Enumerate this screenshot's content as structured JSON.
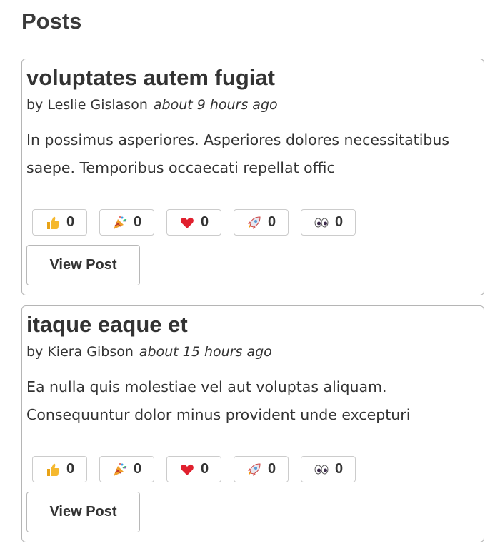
{
  "page": {
    "title": "Posts"
  },
  "posts": [
    {
      "title": "voluptates autem fugiat",
      "author": "by Leslie Gislason",
      "time": "about 9 hours ago",
      "excerpt": "In possimus asperiores. Asperiores dolores necessitatibus saepe. Temporibus occaecati repellat offic",
      "reactions": [
        {
          "icon": "thumbs-up-icon",
          "count": "0"
        },
        {
          "icon": "party-popper-icon",
          "count": "0"
        },
        {
          "icon": "heart-icon",
          "count": "0"
        },
        {
          "icon": "rocket-icon",
          "count": "0"
        },
        {
          "icon": "eyes-icon",
          "count": "0"
        }
      ],
      "view_label": "View Post"
    },
    {
      "title": "itaque eaque et",
      "author": "by Kiera Gibson",
      "time": "about 15 hours ago",
      "excerpt": "Ea nulla quis molestiae vel aut voluptas aliquam. Consequuntur dolor minus provident unde excepturi",
      "reactions": [
        {
          "icon": "thumbs-up-icon",
          "count": "0"
        },
        {
          "icon": "party-popper-icon",
          "count": "0"
        },
        {
          "icon": "heart-icon",
          "count": "0"
        },
        {
          "icon": "rocket-icon",
          "count": "0"
        },
        {
          "icon": "eyes-icon",
          "count": "0"
        }
      ],
      "view_label": "View Post"
    }
  ],
  "colors": {
    "text": "#333333",
    "border": "#b5b5b5",
    "heart": "#e0202e",
    "thumb": "#f5b82e",
    "rocket": "#d9534f"
  }
}
